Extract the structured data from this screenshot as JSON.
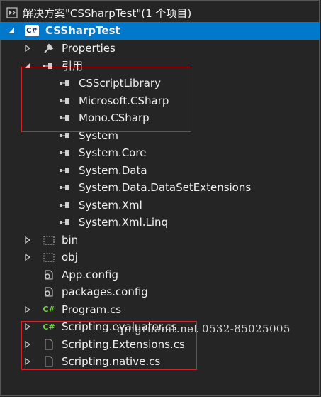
{
  "solution": {
    "title": "解决方案\"CSSharpTest\"(1 个项目)"
  },
  "project": {
    "name": "CSSharpTest",
    "badge": "C#"
  },
  "tree": {
    "properties": "Properties",
    "references_label": "引用",
    "references": [
      "CSScriptLibrary",
      "Microsoft.CSharp",
      "Mono.CSharp",
      "System",
      "System.Core",
      "System.Data",
      "System.Data.DataSetExtensions",
      "System.Xml",
      "System.Xml.Linq"
    ],
    "bin": "bin",
    "obj": "obj",
    "app_config": "App.config",
    "packages_config": "packages.config",
    "program": "Program.cs",
    "scripting_evaluator": "Scripting.evaluator.cs",
    "scripting_extensions": "Scripting.Extensions.cs",
    "scripting_native": "Scripting.native.cs"
  },
  "watermark": "qingruanit.net 0532-85025005",
  "colors": {
    "background": "#252526",
    "selection": "#0079cc",
    "highlight_box": "#d2232a",
    "csharp_icon": "#6ccf3b"
  }
}
